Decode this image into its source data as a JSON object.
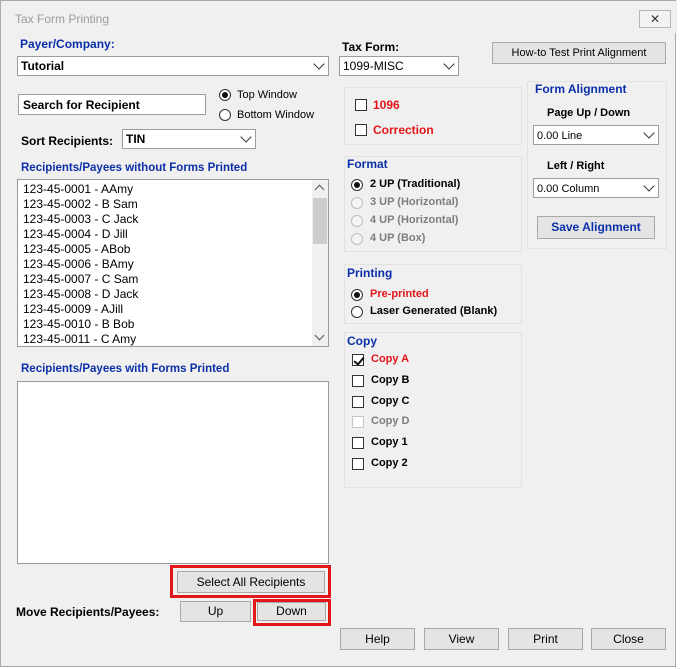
{
  "window": {
    "title": "Tax Form Printing",
    "close_glyph": "✕"
  },
  "payer": {
    "label": "Payer/Company:",
    "value": "Tutorial"
  },
  "tax_form": {
    "label": "Tax Form:",
    "value": "1099-MISC"
  },
  "how_to_button": "How-to Test Print  Alignment",
  "search": {
    "label": "Search for Recipient"
  },
  "window_option": {
    "top": "Top Window",
    "bottom": "Bottom Window",
    "selected": "top"
  },
  "sort": {
    "label": "Sort Recipients:",
    "value": "TIN"
  },
  "without_forms": {
    "label": "Recipients/Payees without Forms Printed",
    "items": [
      "123-45-0001 - AAmy",
      "123-45-0002 - B Sam",
      "123-45-0003 - C Jack",
      "123-45-0004 - D Jill",
      "123-45-0005 - ABob",
      "123-45-0006 - BAmy",
      "123-45-0007 - C Sam",
      "123-45-0008 - D Jack",
      "123-45-0009 - AJill",
      "123-45-0010 - B Bob",
      "123-45-0011 - C Amy"
    ]
  },
  "with_forms": {
    "label": "Recipients/Payees with Forms Printed",
    "items": []
  },
  "select_all_button": "Select All Recipients",
  "move": {
    "label": "Move Recipients/Payees:",
    "up": "Up",
    "down": "Down"
  },
  "form_options": {
    "f1096": "1096",
    "correction": "Correction"
  },
  "format": {
    "title": "Format",
    "options": [
      {
        "label": "2 UP (Traditional)",
        "selected": true,
        "enabled": true
      },
      {
        "label": "3 UP (Horizontal)",
        "selected": false,
        "enabled": false
      },
      {
        "label": "4 UP (Horizontal)",
        "selected": false,
        "enabled": false
      },
      {
        "label": "4 UP (Box)",
        "selected": false,
        "enabled": false
      }
    ]
  },
  "printing": {
    "title": "Printing",
    "options": [
      {
        "label": "Pre-printed",
        "selected": true
      },
      {
        "label": "Laser Generated (Blank)",
        "selected": false
      }
    ]
  },
  "copy": {
    "title": "Copy",
    "items": [
      {
        "label": "Copy A",
        "checked": true,
        "enabled": true
      },
      {
        "label": "Copy B",
        "checked": false,
        "enabled": true
      },
      {
        "label": "Copy C",
        "checked": false,
        "enabled": true
      },
      {
        "label": "Copy D",
        "checked": false,
        "enabled": false
      },
      {
        "label": "Copy 1",
        "checked": false,
        "enabled": true
      },
      {
        "label": "Copy 2",
        "checked": false,
        "enabled": true
      }
    ]
  },
  "alignment": {
    "title": "Form Alignment",
    "page_label": "Page Up / Down",
    "page_value": "0.00 Line",
    "lr_label": "Left / Right",
    "lr_value": "0.00 Column",
    "save_button": "Save  Alignment"
  },
  "bottom_buttons": {
    "help": "Help",
    "view": "View",
    "print": "Print",
    "close": "Close"
  },
  "colors": {
    "label_blue": "#0b2fa8",
    "highlight_red": "#e3161a",
    "window_bg": "#f0f0f0"
  }
}
